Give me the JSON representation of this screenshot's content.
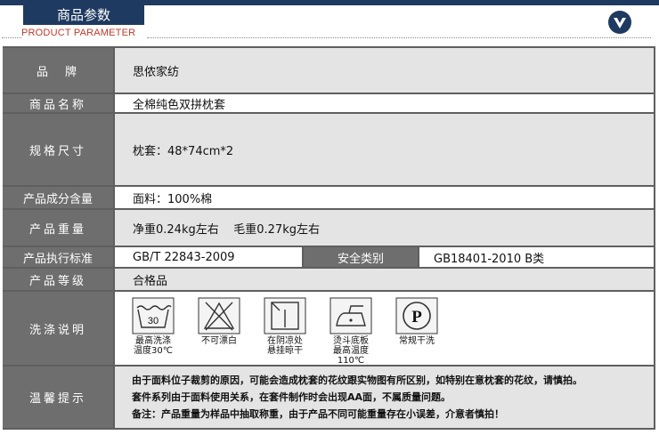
{
  "header": {
    "title": "商品参数",
    "subtitle": "PRODUCT PARAMETER",
    "badge_icon": "chevron-down-circle-icon"
  },
  "params": {
    "brand_label": "品　牌",
    "brand": "思侬家纺",
    "name_label": "商品名称",
    "name": "全棉纯色双拼枕套",
    "spec_label": "规格尺寸",
    "spec": "枕套：48*74cm*2",
    "composition_label": "产品成分含量",
    "composition": "面料：100%棉",
    "weight_label": "产品重量",
    "weight": "净重0.24kg左右    毛重0.27kg左右",
    "standard_label": "产品执行标准",
    "standard": "GB/T 22843-2009",
    "safety_label": "安全类别",
    "safety": "GB18401-2010 B类",
    "grade_label": "产品等级",
    "grade": "合格品",
    "wash_label": "洗涤说明",
    "tips_label": "温馨提示"
  },
  "wash": [
    {
      "icon": "wash-30-icon",
      "text": "30",
      "caption1": "最高洗涤",
      "caption2": "温度30℃"
    },
    {
      "icon": "no-bleach-icon",
      "caption1": "不可漂白",
      "caption2": ""
    },
    {
      "icon": "line-dry-shade-icon",
      "caption1": "在阴凉处",
      "caption2": "悬挂晾干"
    },
    {
      "icon": "iron-icon",
      "caption1": "烫斗底板",
      "caption2": "最高温度110℃"
    },
    {
      "icon": "dry-clean-p-icon",
      "text": "P",
      "caption1": "常规干洗",
      "caption2": ""
    }
  ],
  "tips": [
    "由于面料位子裁剪的原因，可能会造成枕套的花纹跟实物图有所区别，如特别在意枕套的花纹，请慎拍。",
    "套件系列由于面料使用关系，在套件制作时会出现AA面，不属质量问题。",
    "备注：产品重量为样品中抽取称重，由于产品不同可能重量存在小误差，介意者慎拍！"
  ],
  "colors": {
    "header": "#1f3a60",
    "subtitle": "#c0392b",
    "label_bg": "#6e6e6e"
  }
}
